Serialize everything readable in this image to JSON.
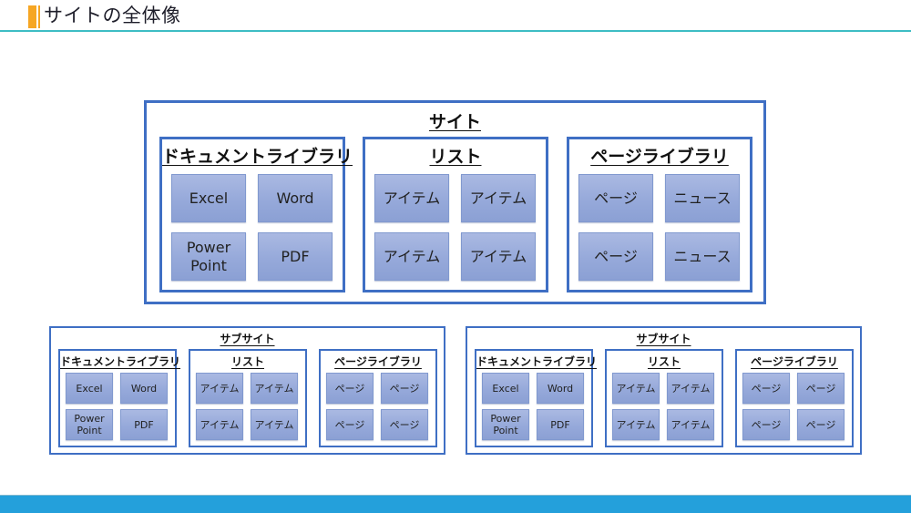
{
  "header": {
    "title": "サイトの全体像",
    "accent_color": "#f6a623",
    "rule_color": "#3dbdc4"
  },
  "footer": {
    "color": "#24a0db"
  },
  "colors": {
    "box_border": "#3f6fc4",
    "tile_fill_top": "#aab9e2",
    "tile_fill_bottom": "#8ba0d4"
  },
  "site": {
    "title": "サイト",
    "libraries": [
      {
        "title": "ドキュメントライブラリ",
        "items": [
          "Excel",
          "Word",
          "Power\nPoint",
          "PDF"
        ]
      },
      {
        "title": "リスト",
        "items": [
          "アイテム",
          "アイテム",
          "アイテム",
          "アイテム"
        ]
      },
      {
        "title": "ページライブラリ",
        "items": [
          "ページ",
          "ニュース",
          "ページ",
          "ニュース"
        ]
      }
    ]
  },
  "subsites": [
    {
      "title": "サブサイト",
      "libraries": [
        {
          "title": "ドキュメントライブラリ",
          "items": [
            "Excel",
            "Word",
            "Power\nPoint",
            "PDF"
          ]
        },
        {
          "title": "リスト",
          "items": [
            "アイテム",
            "アイテム",
            "アイテム",
            "アイテム"
          ]
        },
        {
          "title": "ページライブラリ",
          "items": [
            "ページ",
            "ページ",
            "ページ",
            "ページ"
          ]
        }
      ]
    },
    {
      "title": "サブサイト",
      "libraries": [
        {
          "title": "ドキュメントライブラリ",
          "items": [
            "Excel",
            "Word",
            "Power\nPoint",
            "PDF"
          ]
        },
        {
          "title": "リスト",
          "items": [
            "アイテム",
            "アイテム",
            "アイテム",
            "アイテム"
          ]
        },
        {
          "title": "ページライブラリ",
          "items": [
            "ページ",
            "ページ",
            "ページ",
            "ページ"
          ]
        }
      ]
    }
  ]
}
